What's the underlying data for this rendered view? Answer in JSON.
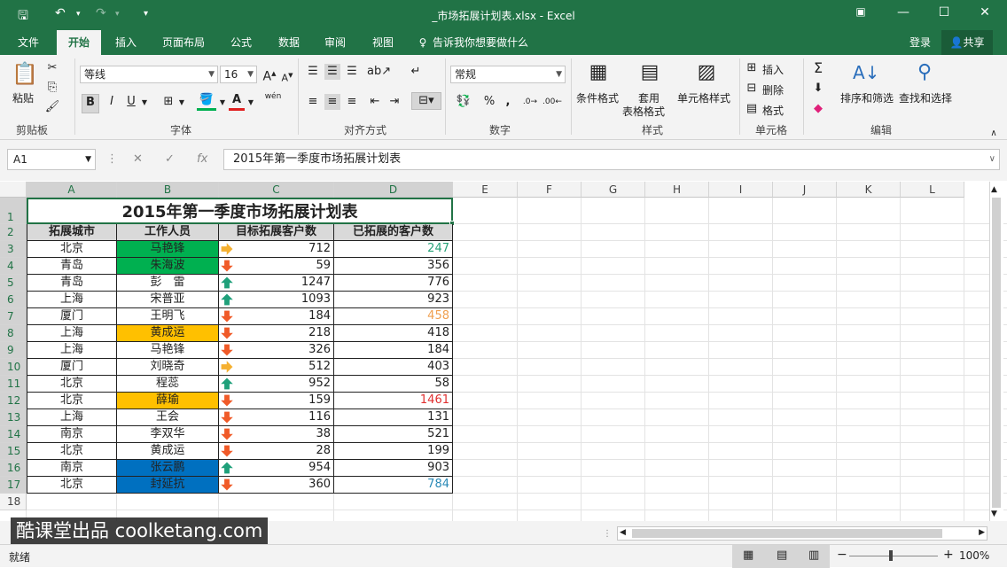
{
  "window": {
    "title": "_市场拓展计划表.xlsx - Excel"
  },
  "tabs": [
    "文件",
    "开始",
    "插入",
    "页面布局",
    "公式",
    "数据",
    "审阅",
    "视图"
  ],
  "active_tab": "开始",
  "tell_me": "告诉我你想要做什么",
  "account": {
    "login": "登录",
    "share": "共享"
  },
  "ribbon": {
    "clipboard": {
      "paste": "粘贴",
      "group": "剪贴板"
    },
    "font": {
      "family": "等线",
      "size": "16",
      "bold": "B",
      "italic": "I",
      "underline": "U",
      "phonetic": "wén",
      "group": "字体"
    },
    "alignment": {
      "group": "对齐方式"
    },
    "number": {
      "format": "常规",
      "percent": "%",
      "comma": ",",
      "group": "数字"
    },
    "styles": {
      "conditional": "条件格式",
      "table_a": "套用",
      "table_b": "表格格式",
      "cell_styles": "单元格样式",
      "group": "样式"
    },
    "cells": {
      "insert": "插入",
      "delete": "删除",
      "format": "格式",
      "group": "单元格"
    },
    "editing": {
      "sort": "排序和筛选",
      "find": "查找和选择",
      "group": "编辑"
    }
  },
  "formula_bar": {
    "name_box": "A1",
    "fx": "fx",
    "content": "2015年第一季度市场拓展计划表"
  },
  "columns": [
    "A",
    "B",
    "C",
    "D",
    "E",
    "F",
    "G",
    "H",
    "I",
    "J",
    "K",
    "L"
  ],
  "rows": [
    "1",
    "2",
    "3",
    "4",
    "5",
    "6",
    "7",
    "8",
    "9",
    "10",
    "11",
    "12",
    "13",
    "14",
    "15",
    "16",
    "17",
    "18"
  ],
  "sheet": {
    "title": "2015年第一季度市场拓展计划表",
    "headers": [
      "拓展城市",
      "工作人员",
      "目标拓展客户数",
      "已拓展的客户数"
    ],
    "data": [
      {
        "city": "北京",
        "person": "马艳锋",
        "target": "712",
        "done": "247",
        "arrow": "right",
        "fill": "#00b050",
        "done_color": "#2aa37a"
      },
      {
        "city": "青岛",
        "person": "朱海波",
        "target": "59",
        "done": "356",
        "arrow": "down",
        "fill": "#00b050",
        "done_color": "#222222"
      },
      {
        "city": "青岛",
        "person": "彭　雷",
        "target": "1247",
        "done": "776",
        "arrow": "up",
        "fill": "",
        "done_color": "#222222"
      },
      {
        "city": "上海",
        "person": "宋普亚",
        "target": "1093",
        "done": "923",
        "arrow": "up",
        "fill": "",
        "done_color": "#222222"
      },
      {
        "city": "厦门",
        "person": "王明飞",
        "target": "184",
        "done": "458",
        "arrow": "down",
        "fill": "",
        "done_color": "#f0a050"
      },
      {
        "city": "上海",
        "person": "黄成运",
        "target": "218",
        "done": "418",
        "arrow": "down",
        "fill": "#ffc000",
        "done_color": "#222222"
      },
      {
        "city": "上海",
        "person": "马艳锋",
        "target": "326",
        "done": "184",
        "arrow": "down",
        "fill": "",
        "done_color": "#222222"
      },
      {
        "city": "厦门",
        "person": "刘晓奇",
        "target": "512",
        "done": "403",
        "arrow": "right",
        "fill": "",
        "done_color": "#222222"
      },
      {
        "city": "北京",
        "person": "程蕊",
        "target": "952",
        "done": "58",
        "arrow": "up",
        "fill": "",
        "done_color": "#222222"
      },
      {
        "city": "北京",
        "person": "薛瑜",
        "target": "159",
        "done": "1461",
        "arrow": "down",
        "fill": "#ffc000",
        "done_color": "#e03030"
      },
      {
        "city": "上海",
        "person": "王会",
        "target": "116",
        "done": "131",
        "arrow": "down",
        "fill": "",
        "done_color": "#222222"
      },
      {
        "city": "南京",
        "person": "李双华",
        "target": "38",
        "done": "521",
        "arrow": "down",
        "fill": "",
        "done_color": "#222222"
      },
      {
        "city": "北京",
        "person": "黄成运",
        "target": "28",
        "done": "199",
        "arrow": "down",
        "fill": "",
        "done_color": "#222222"
      },
      {
        "city": "南京",
        "person": "张云鹏",
        "target": "954",
        "done": "903",
        "arrow": "up",
        "fill": "#0070c0",
        "done_color": "#222222"
      },
      {
        "city": "北京",
        "person": "封延抗",
        "target": "360",
        "done": "784",
        "arrow": "down",
        "fill": "#0070c0",
        "done_color": "#2a8ab7"
      }
    ]
  },
  "status": {
    "ready": "就绪",
    "zoom": "100%"
  },
  "watermark": "酷课堂出品 coolketang.com",
  "colors": {
    "excel_green": "#217346",
    "arrow_up": "#1fa07a",
    "arrow_down": "#f05a28",
    "arrow_right": "#f5b030"
  }
}
